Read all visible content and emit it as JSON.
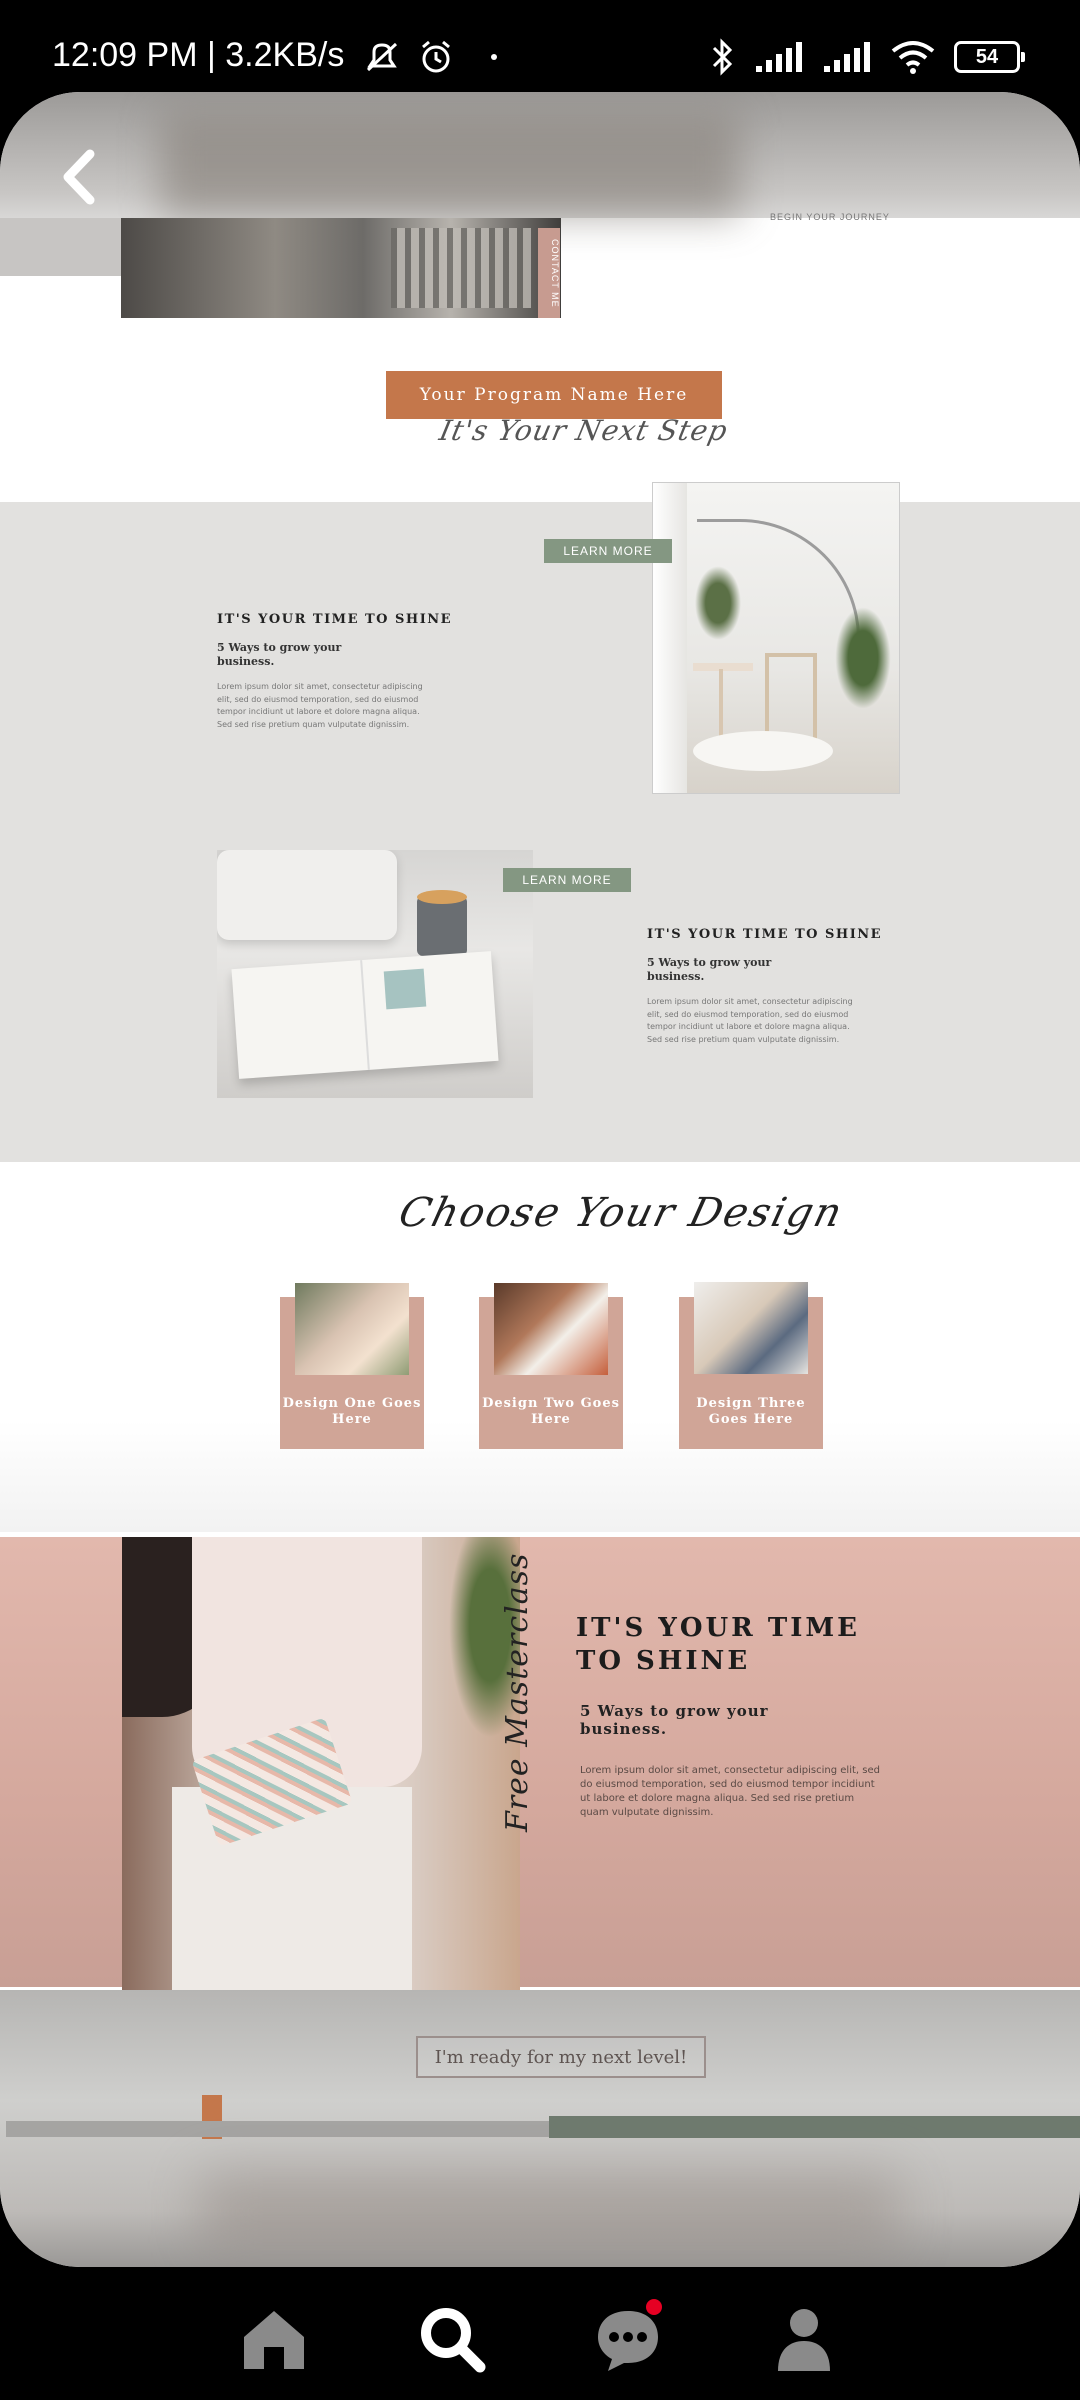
{
  "status_bar": {
    "time_speed": "12:09 PM | 3.2KB/s",
    "battery": "54"
  },
  "pin": {
    "top_tiny_text": "BEGIN YOUR JOURNEY",
    "contact_tab": "CONTACT ME",
    "program_button": "Your Program Name Here",
    "next_step_script": "It's Your Next Step",
    "block1": {
      "learn_more": "LEARN MORE",
      "title": "IT'S YOUR TIME TO SHINE",
      "subtitle": "5 Ways to grow your business.",
      "body": "Lorem ipsum dolor sit amet, consectetur adipiscing elit, sed do eiusmod temporation, sed do eiusmod tempor incidiunt ut labore et dolore magna aliqua. Sed sed rise pretium quam vulputate dignissim."
    },
    "block2": {
      "learn_more": "LEARN MORE",
      "title": "IT'S YOUR TIME TO SHINE",
      "subtitle": "5 Ways to grow your business.",
      "body": "Lorem ipsum dolor sit amet, consectetur adipiscing elit, sed do eiusmod temporation, sed do eiusmod tempor incidiunt ut labore et dolore magna aliqua. Sed sed rise pretium quam vulputate dignissim."
    },
    "choose_design_script": "Choose Your Design",
    "designs": [
      {
        "label": "Design One Goes Here"
      },
      {
        "label": "Design Two Goes Here"
      },
      {
        "label": "Design Three Goes Here"
      }
    ],
    "shine": {
      "vertical_script": "Free Masterclass",
      "title": "IT'S YOUR TIME TO SHINE",
      "subtitle": "5 Ways to grow your business.",
      "body": "Lorem ipsum dolor sit amet, consectetur adipiscing elit, sed do eiusmod temporation, sed do eiusmod tempor incidiunt ut labore et dolore magna aliqua. Sed sed rise pretium quam vulputate dignissim."
    },
    "ready_button": "I'm ready for my next level!"
  },
  "nav": {
    "items": [
      "home-icon",
      "search-icon",
      "messages-icon",
      "profile-icon"
    ],
    "active": "search-icon"
  },
  "colors": {
    "accent_orange": "#c4774b",
    "sage": "#849782",
    "blush": "#d0a597",
    "notification": "#e60023"
  }
}
